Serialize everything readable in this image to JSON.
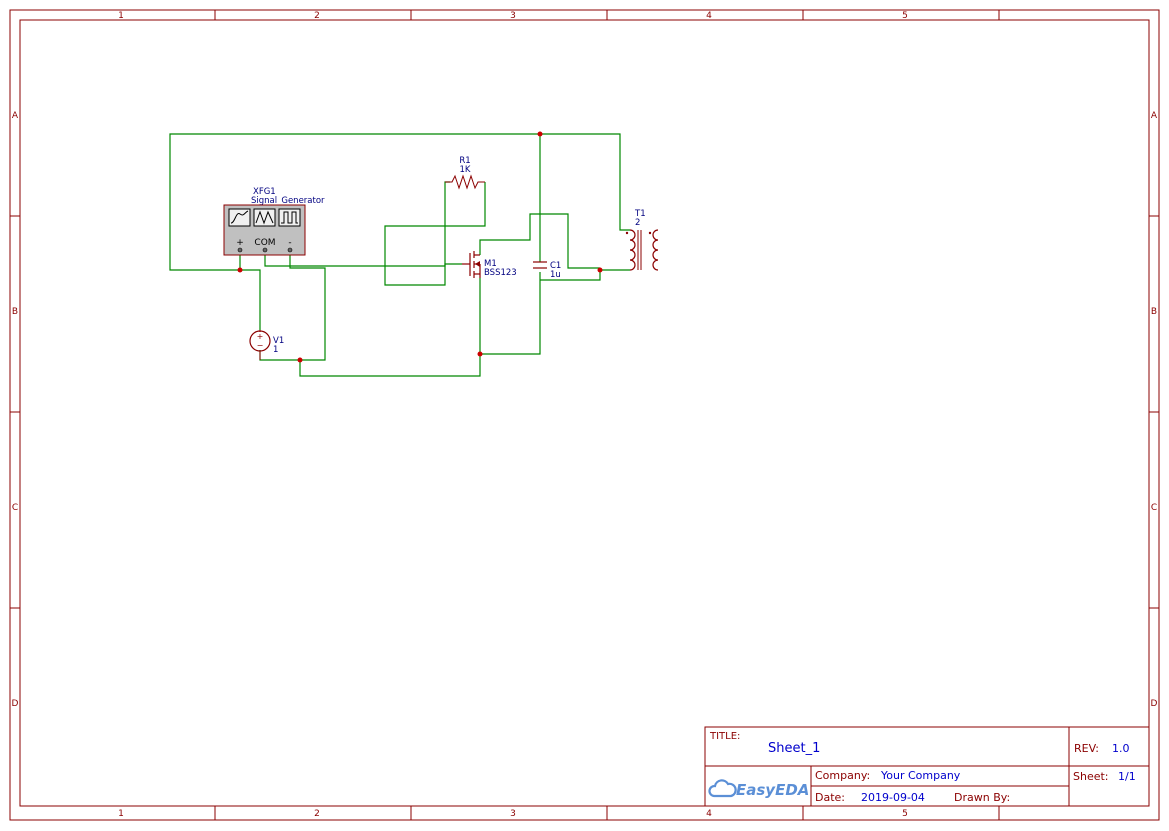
{
  "colors": {
    "frame": "#8b0000",
    "wire": "#008800",
    "junction": "#cc0000",
    "component": "#8b0000",
    "label": "#000080",
    "title_value": "#0000cc",
    "instrument_fill": "#c0c0c0",
    "brand": "#5b8fd6"
  },
  "border": {
    "columns": [
      "1",
      "2",
      "3",
      "4",
      "5"
    ],
    "rows": [
      "A",
      "B",
      "C",
      "D"
    ]
  },
  "components": {
    "xfg1": {
      "ref": "XFG1",
      "value": "Signal_Generator",
      "terminals": {
        "plus": "+",
        "com": "COM",
        "minus": "-"
      }
    },
    "r1": {
      "ref": "R1",
      "value": "1K"
    },
    "m1": {
      "ref": "M1",
      "value": "BSS123"
    },
    "c1": {
      "ref": "C1",
      "value": "1u"
    },
    "t1": {
      "ref": "T1",
      "value": "2"
    },
    "v1": {
      "ref": "V1",
      "value": "1"
    }
  },
  "title_block": {
    "title_label": "TITLE:",
    "title_value": "Sheet_1",
    "rev_label": "REV:",
    "rev_value": "1.0",
    "company_label": "Company:",
    "company_value": "Your Company",
    "sheet_label": "Sheet:",
    "sheet_value": "1/1",
    "date_label": "Date:",
    "date_value": "2019-09-04",
    "drawn_by_label": "Drawn By:",
    "logo_text": "EasyEDA"
  }
}
